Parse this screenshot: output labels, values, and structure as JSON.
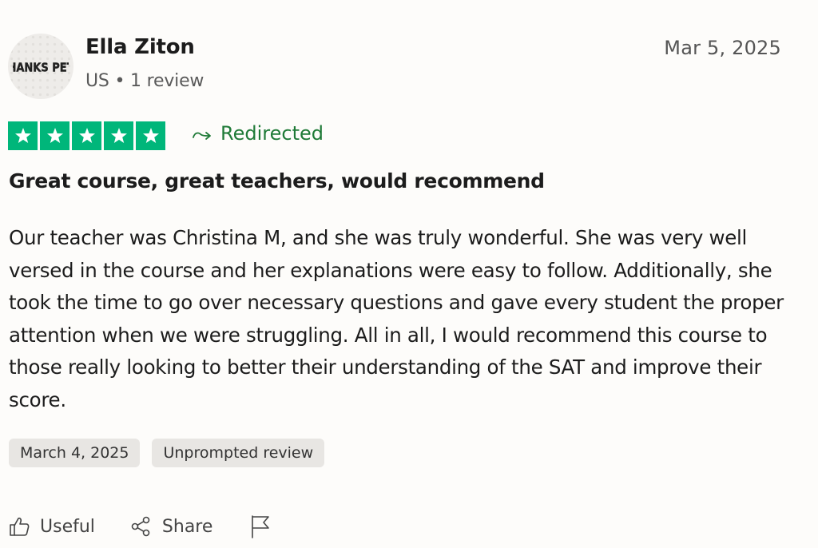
{
  "reviewer": {
    "name": "Ella Ziton",
    "country": "US",
    "review_count": "1 review",
    "avatar_text": "THANKS PETE"
  },
  "review": {
    "date": "Mar 5, 2025",
    "rating": 5,
    "rating_max": 5,
    "star_color": "#00b67a",
    "redirected_label": "Redirected",
    "title": "Great course, great teachers, would recommend",
    "body": "Our teacher was Christina M, and she was truly wonderful. She was very well versed in the course and her explanations were easy to follow. Additionally, she took the time to go over necessary questions and gave every student the proper attention when we were struggling. All in all, I would recommend this course to those really looking to better their understanding of the SAT and improve their score.",
    "tags": [
      "March 4, 2025",
      "Unprompted review"
    ]
  },
  "actions": {
    "useful_label": "Useful",
    "share_label": "Share",
    "useful_icon": "thumbs-up-icon",
    "share_icon": "share-icon",
    "flag_icon": "flag-icon"
  }
}
